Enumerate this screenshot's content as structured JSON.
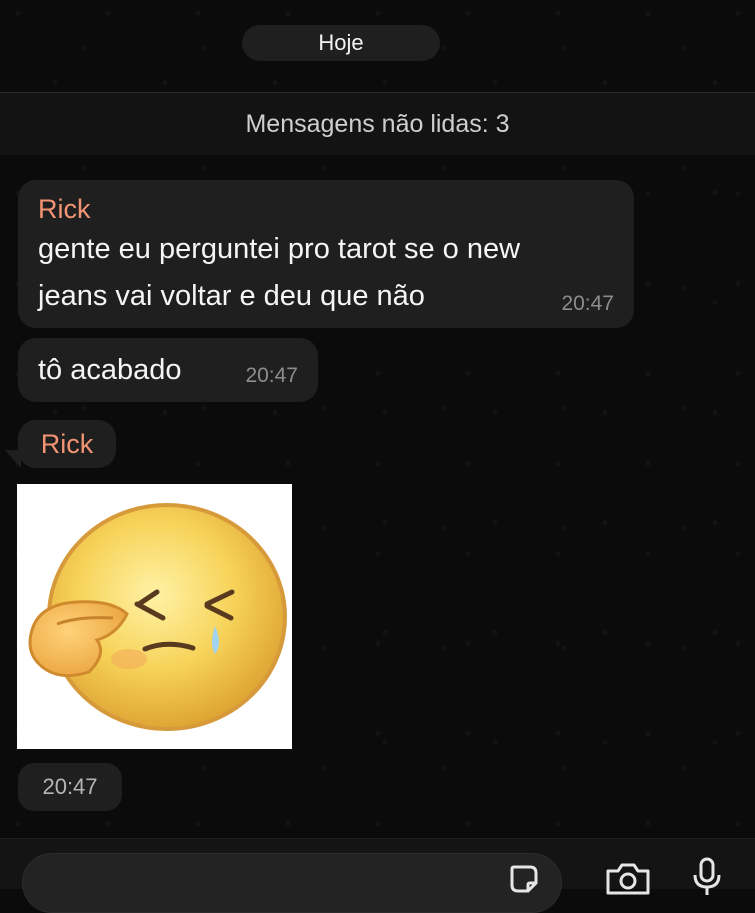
{
  "chat": {
    "date_label": "Hoje",
    "unread_label": "Mensagens não lidas: 3",
    "messages": [
      {
        "sender": "Rick",
        "line1": "gente eu perguntei pro tarot se o new",
        "line2": "jeans vai voltar e deu que não",
        "time": "20:47"
      },
      {
        "text": "tô acabado",
        "time": "20:47"
      },
      {
        "sender": "Rick",
        "sticker": "crying-emoji-sticker",
        "time": "20:47"
      }
    ]
  },
  "input_bar": {
    "icons": [
      "sticker-icon",
      "camera-icon",
      "microphone-icon"
    ]
  },
  "colors": {
    "background": "#0b0b0b",
    "bubble": "#1f1f1f",
    "sender_name": "#f29474",
    "timestamp": "#8d8d8d"
  }
}
